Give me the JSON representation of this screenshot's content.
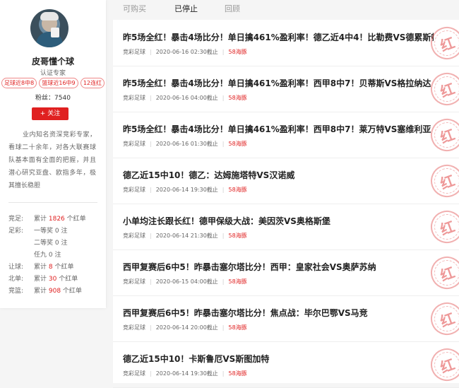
{
  "profile": {
    "name": "皮哥懂个球",
    "title": "认证专家",
    "tags": [
      "足球近8中8",
      "篮球近16中9",
      "12连红"
    ],
    "fans_label": "粉丝：",
    "fans_count": "7540",
    "follow_label": "+ 关注",
    "bio": "业内知名资深竞彩专家，看球二十余年，对各大联赛球队基本面有全面的把握，并且潜心研究亚盘、欧指多年，极其擅长稳胆",
    "stats": [
      {
        "key": "竞足:",
        "pre": "累计 ",
        "num": "1826",
        "post": " 个红单"
      },
      {
        "key": "足彩:",
        "pre": "一等奖 0 注",
        "num": "",
        "post": ""
      },
      {
        "key": "",
        "pre": "二等奖 0 注",
        "num": "",
        "post": ""
      },
      {
        "key": "",
        "pre": "任九 0 注",
        "num": "",
        "post": ""
      },
      {
        "key": "让球:",
        "pre": "累计 ",
        "num": "8",
        "post": " 个红单"
      },
      {
        "key": "北单:",
        "pre": "累计 ",
        "num": "30",
        "post": " 个红单"
      },
      {
        "key": "竞篮:",
        "pre": "累计 ",
        "num": "908",
        "post": " 个红单"
      }
    ]
  },
  "tabs": [
    {
      "label": "可购买",
      "active": false
    },
    {
      "label": "已停止",
      "active": true
    },
    {
      "label": "回顾",
      "active": false
    }
  ],
  "articles": [
    {
      "title": "昨5场全红！暴击4场比分！单日擒461%盈利率！德乙近4中4！比勒费VS德累斯顿",
      "category": "竞彩足球",
      "time": "2020-06-16 02:30截止",
      "price": "58海豚",
      "stamp": "红"
    },
    {
      "title": "昨5场全红！暴击4场比分！单日擒461%盈利率！西甲8中7！贝蒂斯VS格拉纳达",
      "category": "竞彩足球",
      "time": "2020-06-16 04:00截止",
      "price": "58海豚",
      "stamp": "红"
    },
    {
      "title": "昨5场全红！暴击4场比分！单日擒461%盈利率！西甲8中7！莱万特VS塞维利亚",
      "category": "竞彩足球",
      "time": "2020-06-16 01:30截止",
      "price": "58海豚",
      "stamp": "红"
    },
    {
      "title": "德乙近15中10！德乙：达姆施塔特VS汉诺威",
      "category": "竞彩足球",
      "time": "2020-06-14 19:30截止",
      "price": "58海豚",
      "stamp": "红"
    },
    {
      "title": "小单均注长跟长红！德甲保级大战：美因茨VS奥格斯堡",
      "category": "竞彩足球",
      "time": "2020-06-14 21:30截止",
      "price": "58海豚",
      "stamp": "红"
    },
    {
      "title": "西甲复赛后6中5！昨暴击塞尔塔比分！西甲：皇家社会VS奥萨苏纳",
      "category": "竞彩足球",
      "time": "2020-06-15 04:00截止",
      "price": "58海豚",
      "stamp": "红"
    },
    {
      "title": "西甲复赛后6中5！昨暴击塞尔塔比分！焦点战：毕尔巴鄂VS马竞",
      "category": "竞彩足球",
      "time": "2020-06-14 20:00截止",
      "price": "58海豚",
      "stamp": "红"
    },
    {
      "title": "德乙近15中10！卡斯鲁厄VS斯图加特",
      "category": "竞彩足球",
      "time": "2020-06-14 19:30截止",
      "price": "58海豚",
      "stamp": "红"
    }
  ],
  "colors": {
    "accent": "#e02020",
    "background": "#f5f5f5",
    "card": "#ffffff"
  }
}
